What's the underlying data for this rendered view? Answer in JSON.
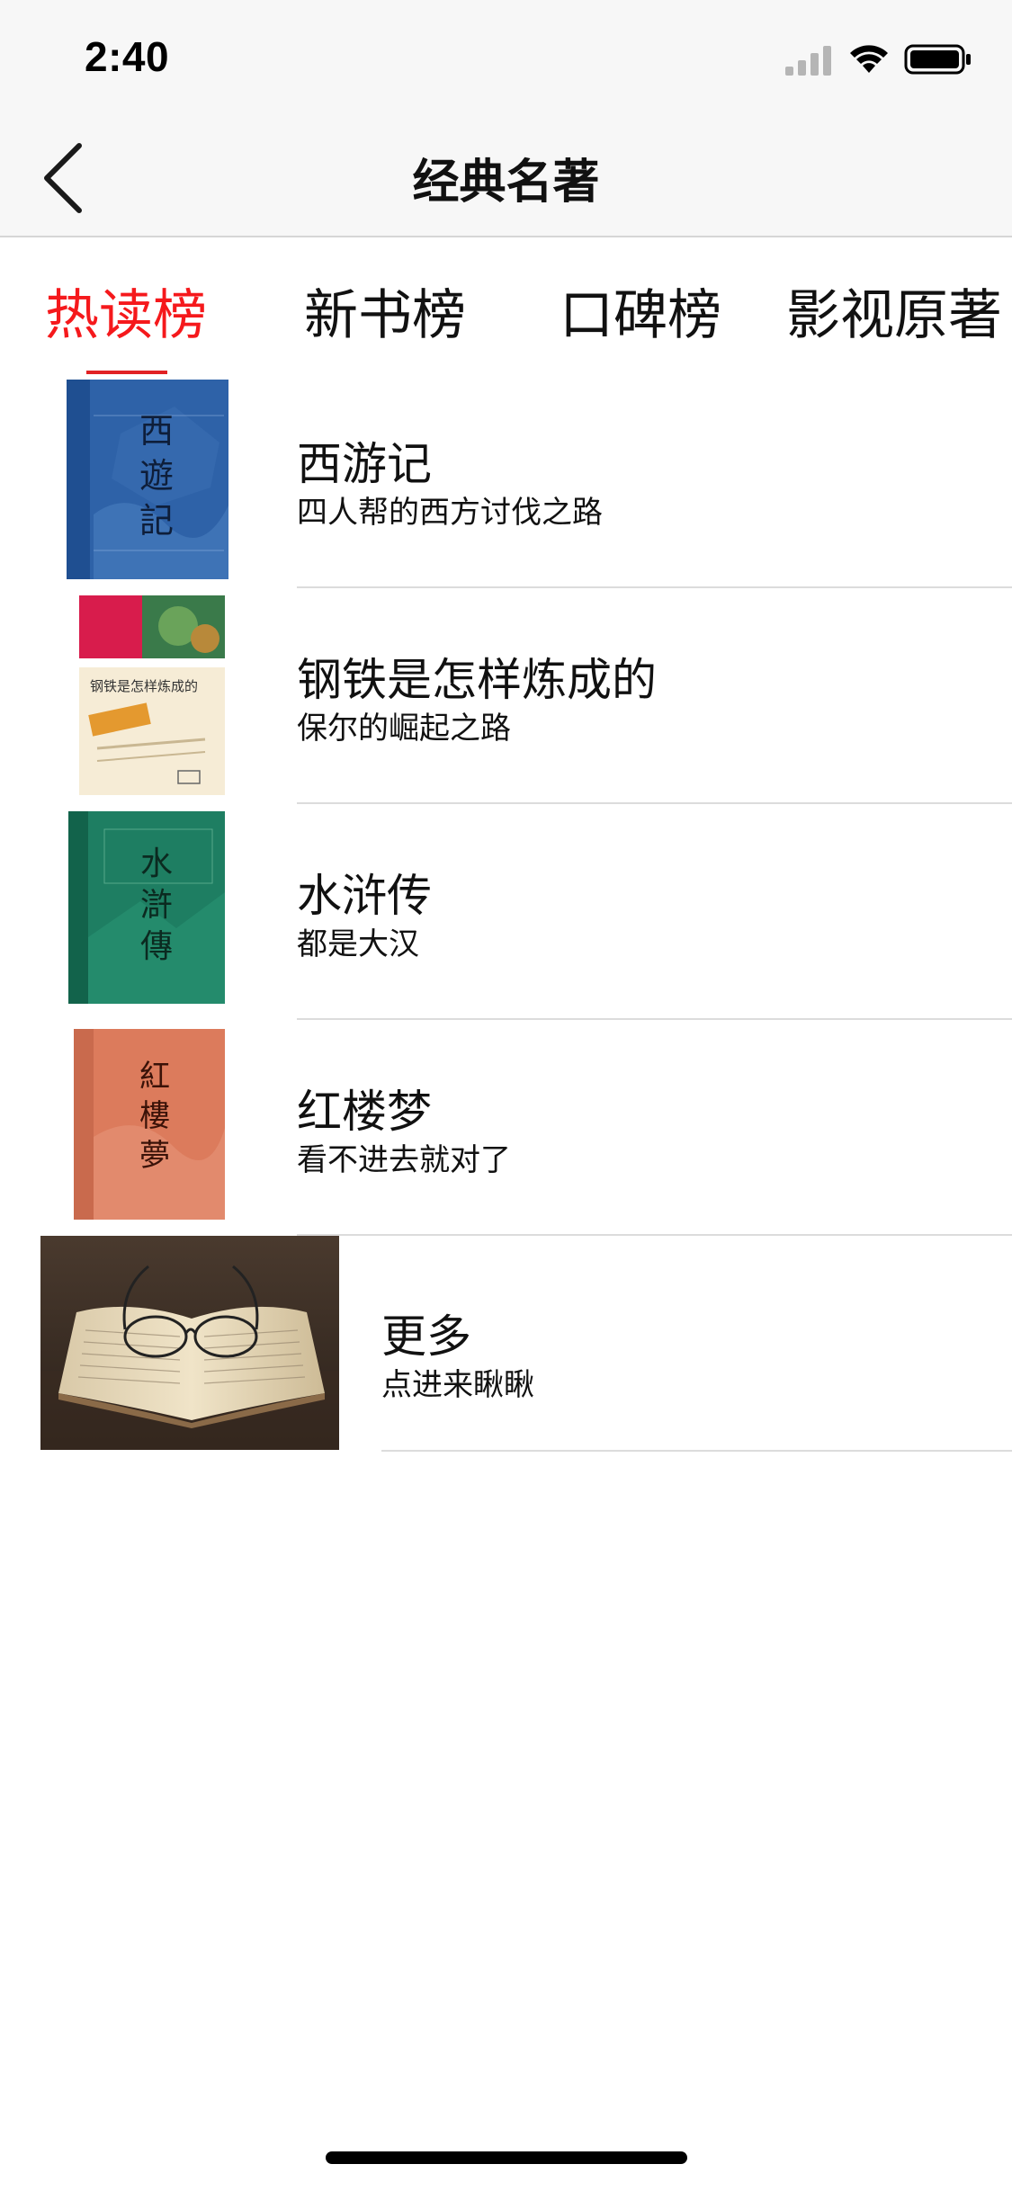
{
  "status_bar": {
    "time": "2:40",
    "icons": [
      "cellular-signal-icon",
      "wifi-icon",
      "battery-icon"
    ]
  },
  "nav": {
    "back_icon": "chevron-left-icon",
    "title": "经典名著"
  },
  "tabs": [
    {
      "label": "热读榜",
      "active": true
    },
    {
      "label": "新书榜",
      "active": false
    },
    {
      "label": "口碑榜",
      "active": false
    },
    {
      "label": "影视原著",
      "active": false
    }
  ],
  "books": [
    {
      "title": "西游记",
      "subtitle": "四人帮的西方讨伐之路",
      "cover_text": "西遊記",
      "cover_color": "#2e62a8"
    },
    {
      "title": "钢铁是怎样炼成的",
      "subtitle": "保尔的崛起之路",
      "cover_text": "钢铁是怎样炼成的",
      "cover_color": "#f4e6c8"
    },
    {
      "title": "水浒传",
      "subtitle": "都是大汉",
      "cover_text": "水滸傳",
      "cover_color": "#1e7e62"
    },
    {
      "title": "红楼梦",
      "subtitle": "看不进去就对了",
      "cover_text": "紅樓夢",
      "cover_color": "#dc7b5c"
    }
  ],
  "more": {
    "title": "更多",
    "subtitle": "点进来瞅瞅",
    "image": "open-book-with-glasses-photo"
  },
  "colors": {
    "accent": "#f5191c",
    "indicator": "#e12224",
    "text": "#111111",
    "divider": "#dcdcdc",
    "nav_background": "#f7f7f7"
  }
}
